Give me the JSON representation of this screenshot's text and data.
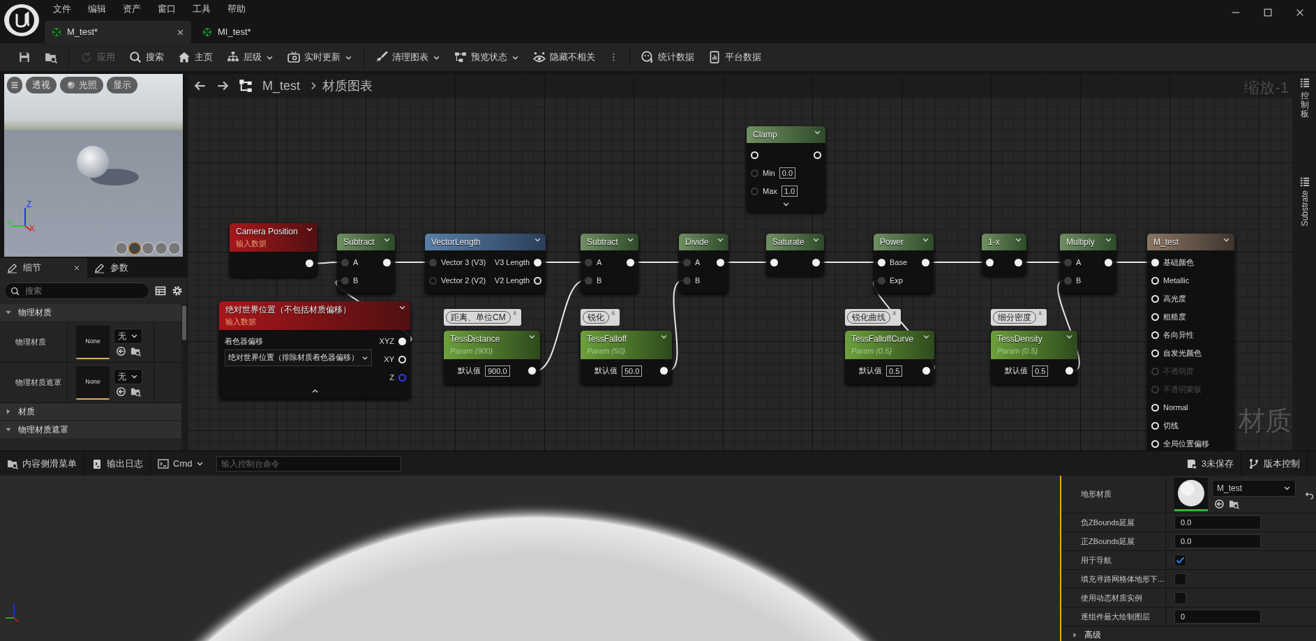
{
  "menu": [
    "文件",
    "编辑",
    "资产",
    "窗口",
    "工具",
    "帮助"
  ],
  "tabs": [
    {
      "label": "M_test*",
      "selected": true
    },
    {
      "label": "MI_test*",
      "selected": false
    }
  ],
  "toolbar_groups": [
    {
      "items": [
        {
          "disabled": false,
          "dropdown": false
        },
        {
          "disabled": false,
          "dropdown": false
        }
      ]
    },
    {
      "items": [
        {
          "label": "应用",
          "disabled": true,
          "dropdown": false
        },
        {
          "label": "搜索",
          "disabled": false,
          "dropdown": false
        },
        {
          "label": "主页",
          "disabled": false,
          "dropdown": false
        },
        {
          "label": "层级",
          "disabled": false,
          "dropdown": true
        },
        {
          "label": "实时更新",
          "disabled": false,
          "dropdown": true
        }
      ]
    },
    {
      "items": [
        {
          "label": "清理图表",
          "disabled": false,
          "dropdown": true
        },
        {
          "label": "预览状态",
          "disabled": false,
          "dropdown": true
        },
        {
          "label": "隐藏不相关",
          "disabled": false,
          "dropdown": false
        },
        {
          "label": "⋮",
          "disabled": false,
          "dropdown": false
        }
      ]
    },
    {
      "items": [
        {
          "label": "统计数据",
          "disabled": false,
          "dropdown": false
        },
        {
          "label": "平台数据",
          "disabled": false,
          "dropdown": false
        }
      ]
    }
  ],
  "viewport": {
    "buttons": [
      {
        "label": "透视"
      },
      {
        "label": "光照"
      },
      {
        "label": "显示"
      }
    ],
    "axes": [
      "Z",
      "Y",
      "X"
    ],
    "preview_shapes": [
      {
        "selected": false
      },
      {
        "selected": true
      },
      {
        "selected": false
      },
      {
        "selected": false
      },
      {
        "selected": false
      }
    ]
  },
  "details": {
    "tabs": [
      {
        "label": "细节",
        "selected": true,
        "closable": true
      },
      {
        "label": "参数",
        "selected": false,
        "closable": false
      }
    ],
    "search": {
      "placeholder": "搜索"
    },
    "sections": [
      {
        "title": "物理材质",
        "expanded": true,
        "rows": [
          {
            "label": "物理材质",
            "asset": "None",
            "choice": "无"
          },
          {
            "label": "物理材质遮罩",
            "asset": "None",
            "choice": "无"
          }
        ]
      },
      {
        "title": "材质",
        "expanded": false
      },
      {
        "title": "物理材质遮罩",
        "expanded": true
      }
    ]
  },
  "graph": {
    "breadcrumb": [
      "M_test",
      "材质图表"
    ],
    "zoom": "缩放-1",
    "watermark": "材质",
    "side_tabs": [
      "控制板",
      "Substrate"
    ],
    "nodes": [
      {
        "kind": "math",
        "title": "Clamp",
        "rows": [
          {
            "in": {
              "kind": "hollow"
            },
            "out": {
              "kind": "hollow"
            }
          },
          {
            "in": {
              "kind": "faint",
              "label": "Min",
              "value": "0.0"
            }
          },
          {
            "in": {
              "kind": "faint",
              "label": "Max",
              "value": "1.0"
            }
          }
        ],
        "advanced_expanded": false
      },
      {
        "kind": "input",
        "title": "Camera Position",
        "subtitle": "输入数据",
        "rows": [
          {
            "out": {
              "kind": "filled"
            }
          }
        ]
      },
      {
        "kind": "math",
        "title": "Subtract",
        "rows": [
          {
            "in": {
              "kind": "dim",
              "label": "A"
            },
            "out": {
              "kind": "filled"
            }
          },
          {
            "in": {
              "kind": "dim",
              "label": "B"
            }
          }
        ]
      },
      {
        "kind": "vector",
        "title": "VectorLength",
        "rows": [
          {
            "in": {
              "kind": "dim",
              "label": "Vector 3 (V3)"
            },
            "out": {
              "kind": "filled",
              "label": "V3 Length"
            }
          },
          {
            "in": {
              "kind": "faint",
              "label": "Vector 2 (V2)"
            },
            "out": {
              "kind": "hollow",
              "label": "V2 Length"
            }
          }
        ]
      },
      {
        "kind": "math",
        "title": "Subtract",
        "rows": [
          {
            "in": {
              "kind": "dim",
              "label": "A"
            },
            "out": {
              "kind": "filled"
            }
          },
          {
            "in": {
              "kind": "dim",
              "label": "B"
            }
          }
        ]
      },
      {
        "kind": "math",
        "title": "Divide",
        "rows": [
          {
            "in": {
              "kind": "dim",
              "label": "A"
            },
            "out": {
              "kind": "filled"
            }
          },
          {
            "in": {
              "kind": "dim",
              "label": "B"
            }
          }
        ]
      },
      {
        "kind": "math",
        "title": "Saturate",
        "rows": [
          {
            "in": {
              "kind": "filled"
            },
            "out": {
              "kind": "filled"
            }
          }
        ]
      },
      {
        "kind": "math",
        "title": "Power",
        "rows": [
          {
            "in": {
              "kind": "filled",
              "label": "Base"
            },
            "out": {
              "kind": "filled"
            }
          },
          {
            "in": {
              "kind": "dim",
              "label": "Exp"
            }
          }
        ]
      },
      {
        "kind": "math",
        "title": "1-x",
        "rows": [
          {
            "in": {
              "kind": "filled"
            },
            "out": {
              "kind": "filled"
            }
          }
        ]
      },
      {
        "kind": "math",
        "title": "Multiply",
        "rows": [
          {
            "in": {
              "kind": "dim",
              "label": "A"
            },
            "out": {
              "kind": "filled"
            }
          },
          {
            "in": {
              "kind": "dim",
              "label": "B"
            }
          }
        ]
      },
      {
        "kind": "input",
        "title": "绝对世界位置（不包括材质偏移）",
        "subtitle": "输入数据",
        "property": {
          "label": "着色器偏移",
          "value": "绝对世界位置（排除材质着色器偏移）"
        },
        "rows": [
          {
            "out": {
              "kind": "filled",
              "label": "XYZ"
            }
          },
          {
            "out": {
              "kind": "hollow",
              "label": "XY"
            }
          },
          {
            "out": {
              "kind": "blue",
              "label": "Z"
            }
          }
        ],
        "advanced_expanded": true
      },
      {
        "kind": "param",
        "title": "TessDistance",
        "subtitle": "Param (900)",
        "comment": "距离、单位CM",
        "rows": [
          {
            "in": {
              "label": "默认值",
              "value": "900.0"
            },
            "out": {
              "kind": "filled"
            }
          }
        ]
      },
      {
        "kind": "param",
        "title": "TessFalloff",
        "subtitle": "Param (50)",
        "comment": "锐化",
        "rows": [
          {
            "in": {
              "label": "默认值",
              "value": "50.0"
            },
            "out": {
              "kind": "filled"
            }
          }
        ]
      },
      {
        "kind": "param",
        "title": "TessFalloffCurve",
        "subtitle": "Param (0.5)",
        "comment": "锐化曲线",
        "rows": [
          {
            "in": {
              "label": "默认值",
              "value": "0.5"
            },
            "out": {
              "kind": "filled"
            }
          }
        ]
      },
      {
        "kind": "param",
        "title": "TessDensity",
        "subtitle": "Param (0.5)",
        "comment": "细分密度",
        "rows": [
          {
            "in": {
              "label": "默认值",
              "value": "0.5"
            },
            "out": {
              "kind": "filled"
            }
          }
        ]
      },
      {
        "kind": "result",
        "title": "M_test",
        "rows": [
          {
            "in": {
              "kind": "filled",
              "label": "基础颜色"
            },
            "disabled": false
          },
          {
            "in": {
              "kind": "hollow",
              "label": "Metallic"
            },
            "disabled": false
          },
          {
            "in": {
              "kind": "hollow",
              "label": "高光度"
            },
            "disabled": false
          },
          {
            "in": {
              "kind": "hollow",
              "label": "粗糙度"
            },
            "disabled": false
          },
          {
            "in": {
              "kind": "hollow",
              "label": "各向异性"
            },
            "disabled": false
          },
          {
            "in": {
              "kind": "hollow",
              "label": "自发光颜色"
            },
            "disabled": false
          },
          {
            "in": {
              "kind": "faint",
              "label": "不透明度"
            },
            "disabled": true
          },
          {
            "in": {
              "kind": "faint",
              "label": "不透明蒙版"
            },
            "disabled": true
          },
          {
            "in": {
              "kind": "hollow",
              "label": "Normal"
            },
            "disabled": false
          },
          {
            "in": {
              "kind": "hollow",
              "label": "切线"
            },
            "disabled": false
          },
          {
            "in": {
              "kind": "hollow",
              "label": "全局位置偏移"
            },
            "disabled": false
          }
        ]
      }
    ]
  },
  "status_bar": {
    "buttons": [
      {
        "label": "内容侧滑菜单"
      },
      {
        "label": "输出日志"
      }
    ],
    "console": {
      "mode": "Cmd",
      "placeholder": "输入控制台命令"
    },
    "right": [
      {
        "label": "3未保存"
      },
      {
        "label": "版本控制"
      }
    ]
  },
  "landscape": {
    "rows": [
      {
        "kind": "asset",
        "label": "地形材质",
        "value": "M_test"
      },
      {
        "kind": "number",
        "label": "负ZBounds延展",
        "value": "0.0"
      },
      {
        "kind": "number",
        "label": "正ZBounds延展",
        "value": "0.0"
      },
      {
        "kind": "check",
        "label": "用于导航",
        "checked": true
      },
      {
        "kind": "check",
        "label": "填充寻路网格体地形下...",
        "checked": false
      },
      {
        "kind": "check",
        "label": "使用动态材质实例",
        "checked": false
      },
      {
        "kind": "number",
        "label": "逐组件最大绘制图层",
        "value": "0"
      }
    ],
    "section": {
      "title": "高级",
      "expanded": false
    }
  }
}
